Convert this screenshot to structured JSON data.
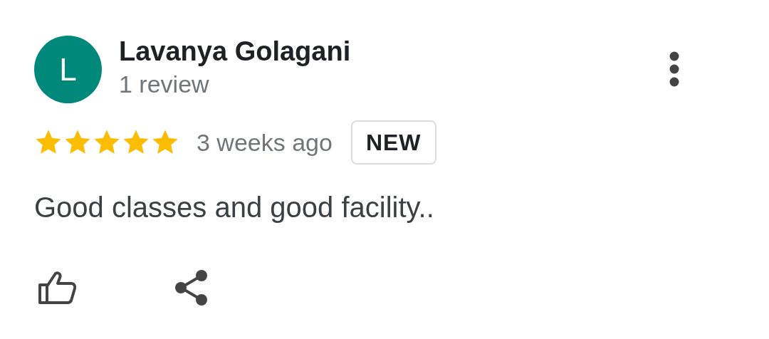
{
  "review": {
    "avatar_letter": "L",
    "name": "Lavanya Golagani",
    "review_count": "1 review",
    "stars": 5,
    "time": "3 weeks ago",
    "badge": "NEW",
    "text": "Good classes and good facility.."
  }
}
